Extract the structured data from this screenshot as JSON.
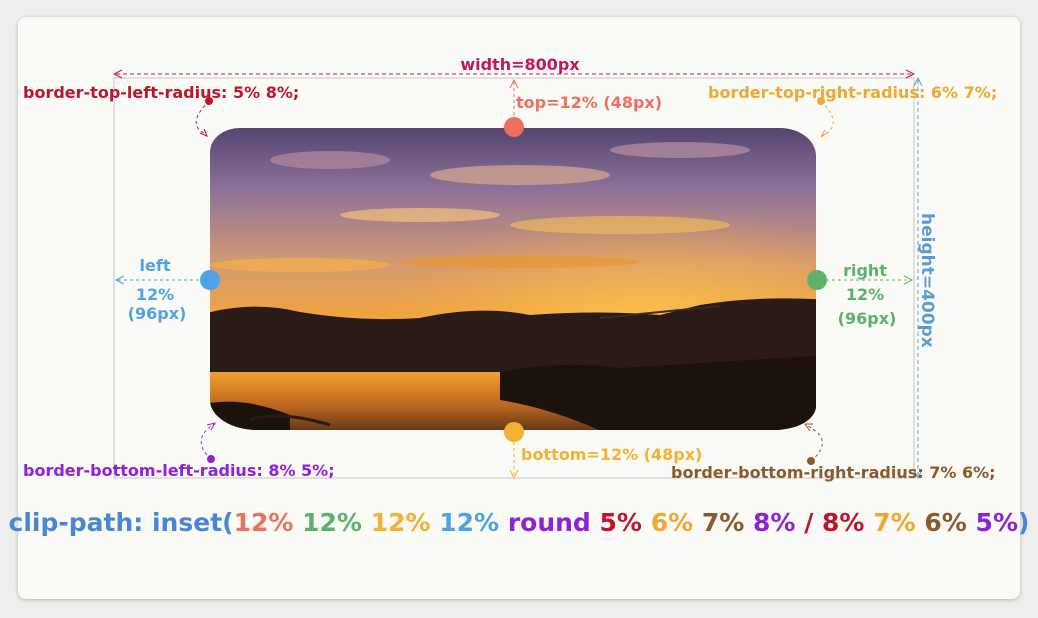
{
  "colors": {
    "frame": "#c8c8c8",
    "width": "#c2185b",
    "height": "#5b9bd5",
    "top": "#ef6f5e",
    "left": "#4da3e8",
    "right": "#5cb26b",
    "bottom": "#f4b134",
    "radius_tl": "#c0142c",
    "radius_tr": "#f0a830",
    "radius_br": "#8a5a2b",
    "radius_bl": "#8f22d6"
  },
  "labels": {
    "width": "width=800px",
    "height": "height=400px",
    "top": "top=12% (48px)",
    "bottom": "bottom=12% (48px)",
    "left_word": "left",
    "left_pct": "12%",
    "left_px": "(96px)",
    "right_word": "right",
    "right_pct": "12%",
    "right_px": "(96px)",
    "radius_tl": "border-top-left-radius: 5%  8%;",
    "radius_tr": "border-top-right-radius: 6%  7%;",
    "radius_bl": "border-bottom-left-radius: 8%  5%;",
    "radius_br": "border-bottom-right-radius: 7%  6%;"
  },
  "image": {
    "subject": "sunset-lake-landscape"
  },
  "formula": [
    {
      "text": "clip-path: inset(",
      "color": "#4a86d6"
    },
    {
      "text": "12%",
      "color": "#ef6f5e"
    },
    {
      "text": " ",
      "color": "#4a86d6"
    },
    {
      "text": "12%",
      "color": "#5cb26b"
    },
    {
      "text": " ",
      "color": "#4a86d6"
    },
    {
      "text": "12%",
      "color": "#f4b134"
    },
    {
      "text": " ",
      "color": "#4a86d6"
    },
    {
      "text": "12%",
      "color": "#4da3e8"
    },
    {
      "text": " round ",
      "color": "#8f22d6"
    },
    {
      "text": "5%",
      "color": "#c0142c"
    },
    {
      "text": " ",
      "color": "#4a86d6"
    },
    {
      "text": "6%",
      "color": "#f0a830"
    },
    {
      "text": " ",
      "color": "#4a86d6"
    },
    {
      "text": "7%",
      "color": "#8a5a2b"
    },
    {
      "text": " ",
      "color": "#4a86d6"
    },
    {
      "text": "8%",
      "color": "#8f22d6"
    },
    {
      "text": " / ",
      "color": "#c0142c"
    },
    {
      "text": "8%",
      "color": "#c0142c"
    },
    {
      "text": " ",
      "color": "#4a86d6"
    },
    {
      "text": "7%",
      "color": "#f0a830"
    },
    {
      "text": " ",
      "color": "#4a86d6"
    },
    {
      "text": "6%",
      "color": "#8a5a2b"
    },
    {
      "text": " ",
      "color": "#4a86d6"
    },
    {
      "text": "5%",
      "color": "#8f22d6"
    },
    {
      "text": ")",
      "color": "#4a86d6"
    }
  ]
}
